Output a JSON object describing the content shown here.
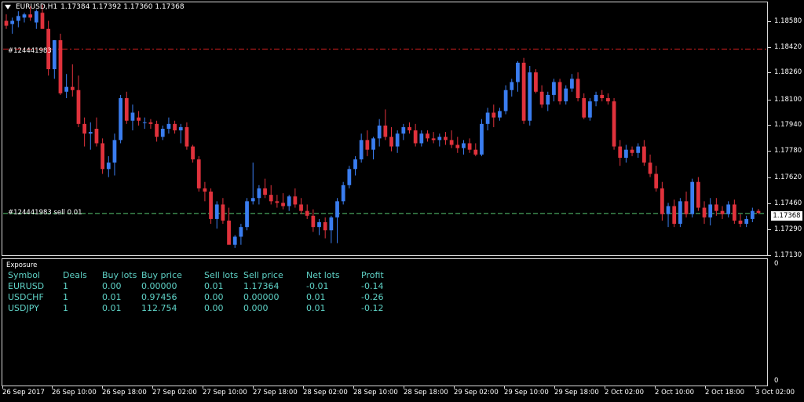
{
  "header": {
    "symbol_timeframe": "EURUSD,H1",
    "ohlc": "1.17384 1.17392 1.17360 1.17368"
  },
  "order_lines": [
    {
      "label": "#124441983",
      "price": 1.18384,
      "color": "#e02020"
    },
    {
      "label": "#124441983 sell 0.01",
      "price": 1.17364,
      "color": "#56c872"
    }
  ],
  "price_axis": {
    "ticks": [
      "1.18580",
      "1.18420",
      "1.18260",
      "1.18100",
      "1.17940",
      "1.17780",
      "1.17620",
      "1.17460",
      "1.17290",
      "1.17130"
    ],
    "current": "1.17368"
  },
  "time_axis": {
    "ticks": [
      "26 Sep 2017",
      "26 Sep 10:00",
      "26 Sep 18:00",
      "27 Sep 02:00",
      "27 Sep 10:00",
      "27 Sep 18:00",
      "28 Sep 02:00",
      "28 Sep 10:00",
      "28 Sep 18:00",
      "29 Sep 02:00",
      "29 Sep 10:00",
      "29 Sep 18:00",
      "2 Oct 02:00",
      "2 Oct 10:00",
      "2 Oct 18:00",
      "3 Oct 02:00"
    ]
  },
  "indicator": {
    "title": "Exposure",
    "scale_top": "0",
    "scale_bottom": "0",
    "columns": [
      "Symbol",
      "Deals",
      "Buy lots",
      "Buy price",
      "Sell lots",
      "Sell price",
      "Net lots",
      "Profit"
    ],
    "rows": [
      [
        "EURUSD",
        "1",
        "0.00",
        "0.00000",
        "0.01",
        "1.17364",
        "-0.01",
        "-0.14"
      ],
      [
        "USDCHF",
        "1",
        "0.01",
        "0.97456",
        "0.00",
        "0.00000",
        "0.01",
        "-0.26"
      ],
      [
        "USDJPY",
        "1",
        "0.01",
        "112.754",
        "0.00",
        "0.000",
        "0.01",
        "-0.12"
      ]
    ]
  },
  "colors": {
    "bull": "#3a7df0",
    "bear": "#e0323c",
    "grid_frame": "#d8d8d8",
    "table_text": "#5fd3c7"
  },
  "chart_data": {
    "type": "candlestick",
    "title": "EURUSD,H1",
    "ylim": [
      1.1712,
      1.1866
    ],
    "candles": [
      [
        1.1856,
        1.186,
        1.1851,
        1.1853
      ],
      [
        1.1854,
        1.1858,
        1.1848,
        1.1856
      ],
      [
        1.1856,
        1.1862,
        1.1852,
        1.1859
      ],
      [
        1.1858,
        1.1861,
        1.1855,
        1.186
      ],
      [
        1.186,
        1.1865,
        1.1856,
        1.1858
      ],
      [
        1.1855,
        1.1863,
        1.1851,
        1.1862
      ],
      [
        1.1861,
        1.1866,
        1.1856,
        1.1851
      ],
      [
        1.1851,
        1.1856,
        1.1822,
        1.1826
      ],
      [
        1.1826,
        1.1844,
        1.182,
        1.1844
      ],
      [
        1.1844,
        1.1848,
        1.181,
        1.1811
      ],
      [
        1.1812,
        1.1823,
        1.1808,
        1.1815
      ],
      [
        1.1815,
        1.1829,
        1.1809,
        1.1813
      ],
      [
        1.1813,
        1.1822,
        1.179,
        1.1792
      ],
      [
        1.1792,
        1.1796,
        1.1778,
        1.1786
      ],
      [
        1.1786,
        1.1793,
        1.1776,
        1.1787
      ],
      [
        1.1789,
        1.1796,
        1.1778,
        1.178
      ],
      [
        1.178,
        1.1783,
        1.1761,
        1.1764
      ],
      [
        1.1764,
        1.1772,
        1.1759,
        1.1768
      ],
      [
        1.1768,
        1.1786,
        1.176,
        1.1782
      ],
      [
        1.1782,
        1.181,
        1.178,
        1.1808
      ],
      [
        1.1808,
        1.1812,
        1.1792,
        1.1794
      ],
      [
        1.1794,
        1.1804,
        1.1788,
        1.1799
      ],
      [
        1.1796,
        1.18,
        1.1791,
        1.1794
      ],
      [
        1.1793,
        1.1796,
        1.1789,
        1.1793
      ],
      [
        1.1793,
        1.1795,
        1.1789,
        1.1792
      ],
      [
        1.1792,
        1.1794,
        1.1781,
        1.1784
      ],
      [
        1.1784,
        1.1791,
        1.1782,
        1.1789
      ],
      [
        1.1789,
        1.1796,
        1.1786,
        1.1792
      ],
      [
        1.1792,
        1.1794,
        1.1786,
        1.1788
      ],
      [
        1.1788,
        1.1792,
        1.178,
        1.179
      ],
      [
        1.179,
        1.1793,
        1.1776,
        1.1778
      ],
      [
        1.1778,
        1.1779,
        1.1768,
        1.177
      ],
      [
        1.177,
        1.1772,
        1.175,
        1.1752
      ],
      [
        1.1752,
        1.1756,
        1.1744,
        1.175
      ],
      [
        1.175,
        1.1752,
        1.173,
        1.1733
      ],
      [
        1.1733,
        1.1744,
        1.1727,
        1.1742
      ],
      [
        1.1742,
        1.1746,
        1.173,
        1.1732
      ],
      [
        1.1732,
        1.174,
        1.172,
        1.1717
      ],
      [
        1.1717,
        1.1723,
        1.1715,
        1.1722
      ],
      [
        1.1722,
        1.173,
        1.1717,
        1.1728
      ],
      [
        1.1728,
        1.1746,
        1.1726,
        1.1744
      ],
      [
        1.1744,
        1.1768,
        1.1742,
        1.1746
      ],
      [
        1.1746,
        1.1754,
        1.1742,
        1.1752
      ],
      [
        1.1752,
        1.1758,
        1.1746,
        1.1748
      ],
      [
        1.1748,
        1.1754,
        1.1742,
        1.1744
      ],
      [
        1.1744,
        1.1748,
        1.174,
        1.1743
      ],
      [
        1.1743,
        1.1749,
        1.1739,
        1.1741
      ],
      [
        1.1741,
        1.1748,
        1.1738,
        1.1747
      ],
      [
        1.1747,
        1.1752,
        1.174,
        1.1742
      ],
      [
        1.1742,
        1.1746,
        1.1736,
        1.1738
      ],
      [
        1.1738,
        1.1742,
        1.1733,
        1.1735
      ],
      [
        1.1735,
        1.1739,
        1.1725,
        1.1728
      ],
      [
        1.1728,
        1.1733,
        1.1723,
        1.1731
      ],
      [
        1.1731,
        1.1734,
        1.1721,
        1.1726
      ],
      [
        1.1726,
        1.1735,
        1.1718,
        1.1734
      ],
      [
        1.1734,
        1.1746,
        1.1718,
        1.1744
      ],
      [
        1.1744,
        1.1756,
        1.1742,
        1.1754
      ],
      [
        1.1754,
        1.1766,
        1.1752,
        1.1764
      ],
      [
        1.1764,
        1.1772,
        1.176,
        1.177
      ],
      [
        1.177,
        1.1786,
        1.1768,
        1.1782
      ],
      [
        1.1782,
        1.1788,
        1.1772,
        1.1776
      ],
      [
        1.1776,
        1.1784,
        1.177,
        1.1783
      ],
      [
        1.1783,
        1.1795,
        1.1778,
        1.1791
      ],
      [
        1.1791,
        1.1801,
        1.1782,
        1.1784
      ],
      [
        1.1784,
        1.179,
        1.1775,
        1.1778
      ],
      [
        1.1778,
        1.1788,
        1.1774,
        1.1786
      ],
      [
        1.1786,
        1.1792,
        1.1782,
        1.179
      ],
      [
        1.179,
        1.1793,
        1.1786,
        1.1788
      ],
      [
        1.1788,
        1.1792,
        1.1778,
        1.178
      ],
      [
        1.178,
        1.1788,
        1.1778,
        1.1786
      ],
      [
        1.1786,
        1.1788,
        1.1781,
        1.1783
      ],
      [
        1.1783,
        1.1787,
        1.178,
        1.1782
      ],
      [
        1.1782,
        1.1786,
        1.1778,
        1.1784
      ],
      [
        1.1784,
        1.1787,
        1.1779,
        1.1782
      ],
      [
        1.1782,
        1.1788,
        1.1777,
        1.1779
      ],
      [
        1.1779,
        1.1784,
        1.1774,
        1.1777
      ],
      [
        1.1777,
        1.1782,
        1.1773,
        1.178
      ],
      [
        1.178,
        1.1783,
        1.1774,
        1.1776
      ],
      [
        1.1776,
        1.178,
        1.1772,
        1.1773
      ],
      [
        1.1773,
        1.1795,
        1.1772,
        1.1792
      ],
      [
        1.1792,
        1.1802,
        1.1788,
        1.1799
      ],
      [
        1.1799,
        1.1804,
        1.179,
        1.1796
      ],
      [
        1.1796,
        1.1802,
        1.1794,
        1.18
      ],
      [
        1.18,
        1.1816,
        1.1798,
        1.1813
      ],
      [
        1.1813,
        1.182,
        1.1809,
        1.1818
      ],
      [
        1.1818,
        1.1831,
        1.1812,
        1.183
      ],
      [
        1.183,
        1.1833,
        1.1792,
        1.1794
      ],
      [
        1.1794,
        1.1828,
        1.1791,
        1.1824
      ],
      [
        1.1824,
        1.1826,
        1.1811,
        1.1812
      ],
      [
        1.1812,
        1.1816,
        1.1802,
        1.1804
      ],
      [
        1.1804,
        1.1812,
        1.18,
        1.181
      ],
      [
        1.181,
        1.182,
        1.1806,
        1.1818
      ],
      [
        1.1818,
        1.182,
        1.1804,
        1.1806
      ],
      [
        1.1806,
        1.1816,
        1.1804,
        1.1814
      ],
      [
        1.1814,
        1.1823,
        1.1812,
        1.182
      ],
      [
        1.182,
        1.1824,
        1.1806,
        1.1808
      ],
      [
        1.1808,
        1.1811,
        1.1795,
        1.1796
      ],
      [
        1.1796,
        1.1808,
        1.1794,
        1.1806
      ],
      [
        1.1806,
        1.1812,
        1.1803,
        1.181
      ],
      [
        1.181,
        1.1813,
        1.1806,
        1.1808
      ],
      [
        1.1808,
        1.1811,
        1.1804,
        1.1806
      ],
      [
        1.1806,
        1.1808,
        1.1776,
        1.1778
      ],
      [
        1.1778,
        1.1782,
        1.1766,
        1.1771
      ],
      [
        1.1771,
        1.1779,
        1.1768,
        1.1776
      ],
      [
        1.1776,
        1.1778,
        1.1772,
        1.1774
      ],
      [
        1.1774,
        1.178,
        1.1771,
        1.1778
      ],
      [
        1.1778,
        1.1782,
        1.1766,
        1.1768
      ],
      [
        1.1768,
        1.1773,
        1.1759,
        1.1761
      ],
      [
        1.1761,
        1.1766,
        1.175,
        1.1752
      ],
      [
        1.1752,
        1.1756,
        1.1732,
        1.1736
      ],
      [
        1.1736,
        1.1743,
        1.1728,
        1.1741
      ],
      [
        1.1741,
        1.1745,
        1.1728,
        1.173
      ],
      [
        1.173,
        1.1746,
        1.1728,
        1.1744
      ],
      [
        1.1744,
        1.175,
        1.1734,
        1.1736
      ],
      [
        1.1736,
        1.1758,
        1.1734,
        1.1756
      ],
      [
        1.1756,
        1.1759,
        1.1738,
        1.174
      ],
      [
        1.174,
        1.1744,
        1.173,
        1.1734
      ],
      [
        1.1734,
        1.1746,
        1.1729,
        1.1742
      ],
      [
        1.1742,
        1.1746,
        1.1735,
        1.1738
      ],
      [
        1.1738,
        1.1741,
        1.1733,
        1.1736
      ],
      [
        1.1736,
        1.1744,
        1.1734,
        1.1742
      ],
      [
        1.1742,
        1.1745,
        1.173,
        1.1732
      ],
      [
        1.1732,
        1.1736,
        1.1728,
        1.173
      ],
      [
        1.173,
        1.1735,
        1.1728,
        1.1733
      ],
      [
        1.1733,
        1.174,
        1.1731,
        1.1738
      ],
      [
        1.1738,
        1.17392,
        1.1736,
        1.17368
      ]
    ]
  }
}
